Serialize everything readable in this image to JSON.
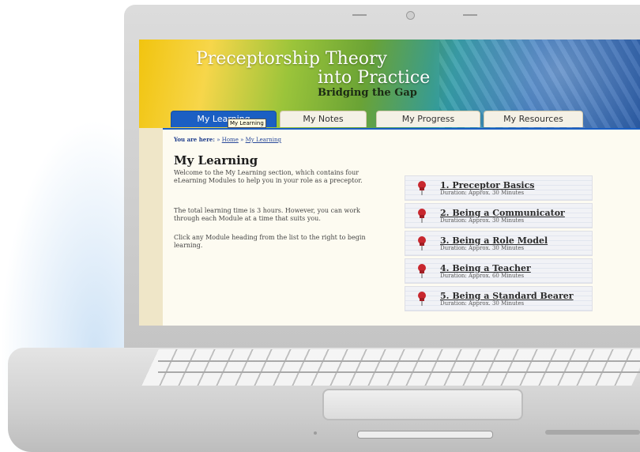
{
  "site": {
    "title_line1": "Preceptorship Theory",
    "title_line2": "into Practice",
    "subtitle": "Bridging the Gap"
  },
  "tabs": [
    {
      "label": "My Learning",
      "active": true
    },
    {
      "label": "My Notes",
      "active": false
    },
    {
      "label": "My Progress",
      "active": false
    },
    {
      "label": "My Resources",
      "active": false
    }
  ],
  "tooltip": "My Learning",
  "breadcrumb": {
    "label": "You are here:",
    "sep": "»",
    "home": "Home",
    "current": "My Learning"
  },
  "page": {
    "heading": "My Learning",
    "para1": "Welcome to the My Learning section, which contains four eLearning Modules to help you in your role as a preceptor.",
    "para2": "The total learning time is 3 hours. However, you can work through each Module at a time that suits you.",
    "para3": "Click any Module heading from the list to the right to begin learning."
  },
  "modules": [
    {
      "title": "1. Preceptor Basics",
      "duration": "Duration: Approx. 30 Minutes"
    },
    {
      "title": "2. Being a Communicator",
      "duration": "Duration: Approx. 30 Minutes"
    },
    {
      "title": "3. Being a Role Model",
      "duration": "Duration: Approx. 30 Minutes"
    },
    {
      "title": "4. Being a Teacher",
      "duration": "Duration: Approx. 60 Minutes"
    },
    {
      "title": "5. Being a Standard Bearer",
      "duration": "Duration: Approx. 30 Minutes"
    }
  ],
  "colors": {
    "tab_active": "#1b5fc3",
    "pin": "#c8272e",
    "content_bg": "#fdfbf1"
  },
  "icons": [
    "push-pin-icon"
  ]
}
